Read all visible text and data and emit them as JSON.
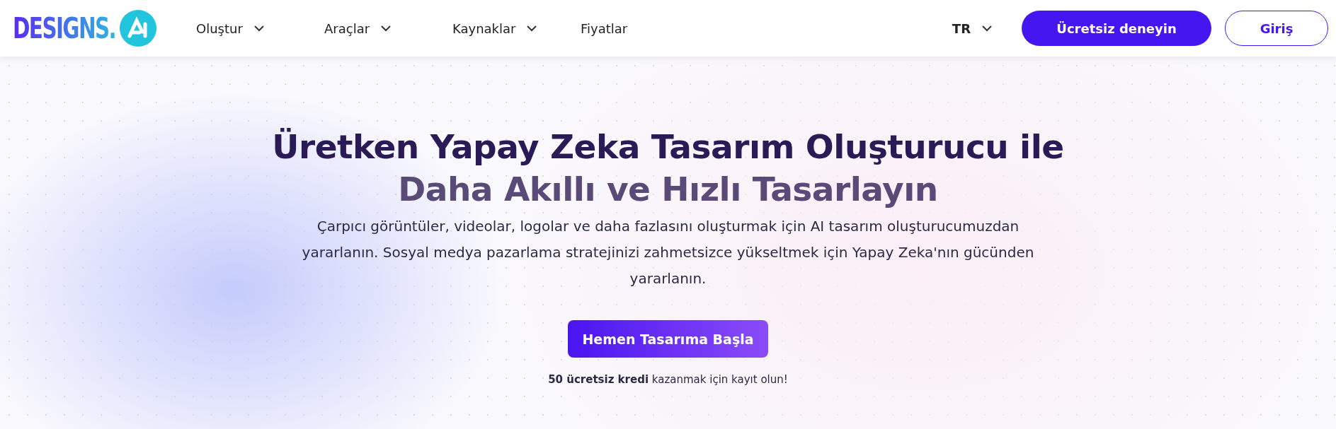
{
  "header": {
    "logo": "DESIGNS.",
    "nav": [
      {
        "label": "Oluştur",
        "dropdown": true
      },
      {
        "label": "Araçlar",
        "dropdown": true
      },
      {
        "label": "Kaynaklar",
        "dropdown": true
      },
      {
        "label": "Fiyatlar",
        "dropdown": false
      }
    ],
    "language": "TR",
    "buttons": [
      {
        "label": "Ücretsiz deneyin",
        "kind": "primary"
      },
      {
        "label": "Giriş",
        "kind": "outline"
      }
    ]
  },
  "hero": {
    "title_lines": [
      "Üretken Yapay Zeka Tasarım Oluşturucu ile",
      "Daha Akıllı ve Hızlı Tasarlayın"
    ],
    "description": "Çarpıcı görüntüler, videolar, logolar ve daha fazlasını oluşturmak için AI tasarım oluşturucumuzdan yararlanın. Sosyal medya pazarlama stratejinizi zahmetsizce yükseltmek için Yapay Zeka'nın gücünden yararlanın.",
    "cta": "Hemen Tasarıma Başla",
    "note": "**50 ücretsiz kredi** kazanmak için kayıt olun!"
  }
}
